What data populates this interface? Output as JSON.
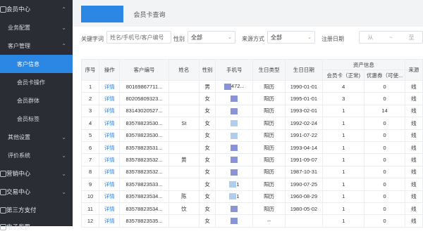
{
  "sidebar": {
    "sections": [
      {
        "label": "会员中心",
        "type": "top",
        "chevron": "⌃"
      },
      {
        "label": "业务配置",
        "type": "group",
        "chevron": "⌄"
      },
      {
        "label": "客户管理",
        "type": "group",
        "chevron": "⌃"
      },
      {
        "label": "客户信息",
        "type": "sub",
        "active": true
      },
      {
        "label": "会员卡操作",
        "type": "sub"
      },
      {
        "label": "会员群体",
        "type": "sub"
      },
      {
        "label": "会员标签",
        "type": "sub"
      },
      {
        "label": "其他设置",
        "type": "group",
        "chevron": "⌄"
      },
      {
        "label": "评价系统",
        "type": "group",
        "chevron": "⌄"
      },
      {
        "label": "营销中心",
        "type": "top",
        "chevron": "⌄"
      },
      {
        "label": "交易中心",
        "type": "top",
        "chevron": "⌄"
      },
      {
        "label": "第三方支付",
        "type": "top"
      },
      {
        "label": "电子发票",
        "type": "top"
      }
    ]
  },
  "tabs": [
    {
      "label": ""
    },
    {
      "label": "会员卡查询"
    }
  ],
  "filters": {
    "keyword_label": "关键字词",
    "keyword_placeholder": "姓名/手机号/客户编号",
    "gender_label": "性别",
    "gender_value": "全部",
    "source_label": "来源方式",
    "source_value": "全部",
    "regdate_label": "注册日期",
    "date_from": "从",
    "date_sep": "~",
    "date_to": "至"
  },
  "table": {
    "group_header": "资产信息",
    "headers": [
      "序号",
      "操作",
      "客户编号",
      "姓名",
      "性别",
      "手机号",
      "生日类型",
      "生日日期",
      "会员卡（正常)",
      "优惠券（可使...",
      "来源"
    ],
    "rows": [
      {
        "no": "1",
        "op": "详情",
        "id": "80169867711...",
        "name": "",
        "gender": "男",
        "phone": "472...",
        "btype": "阳历",
        "bdate": "1990-01-01",
        "card": "4",
        "coupon": "0",
        "src": "线"
      },
      {
        "no": "2",
        "op": "详情",
        "id": "80205809323...",
        "name": "",
        "gender": "女",
        "phone": "",
        "btype": "阳历",
        "bdate": "1995-01-01",
        "card": "3",
        "coupon": "0",
        "src": "线"
      },
      {
        "no": "3",
        "op": "详情",
        "id": "83143020527...",
        "name": "",
        "gender": "女",
        "phone": "",
        "btype": "阳历",
        "bdate": "1993-02-01",
        "card": "1",
        "coupon": "14",
        "src": "线"
      },
      {
        "no": "4",
        "op": "详情",
        "id": "83578823530...",
        "name": "St",
        "gender": "女",
        "phone": "",
        "btype": "阳历",
        "bdate": "1992-02-24",
        "card": "1",
        "coupon": "0",
        "src": "线"
      },
      {
        "no": "5",
        "op": "详情",
        "id": "83578823530...",
        "name": "",
        "gender": "女",
        "phone": "",
        "btype": "阳历",
        "bdate": "1991-07-22",
        "card": "1",
        "coupon": "0",
        "src": "线"
      },
      {
        "no": "6",
        "op": "详情",
        "id": "83578823531...",
        "name": "",
        "gender": "女",
        "phone": "",
        "btype": "阳历",
        "bdate": "1993-04-14",
        "card": "1",
        "coupon": "0",
        "src": "线"
      },
      {
        "no": "7",
        "op": "详情",
        "id": "83578823532...",
        "name": "黄",
        "gender": "女",
        "phone": "",
        "btype": "阳历",
        "bdate": "1991-09-07",
        "card": "1",
        "coupon": "0",
        "src": "线"
      },
      {
        "no": "8",
        "op": "详情",
        "id": "83578823532...",
        "name": "",
        "gender": "女",
        "phone": "",
        "btype": "阳历",
        "bdate": "1987-10-31",
        "card": "1",
        "coupon": "0",
        "src": "线"
      },
      {
        "no": "9",
        "op": "详情",
        "id": "83578823533...",
        "name": "",
        "gender": "女",
        "phone": "1",
        "btype": "阳历",
        "bdate": "1990-07-25",
        "card": "1",
        "coupon": "0",
        "src": "线"
      },
      {
        "no": "10",
        "op": "详情",
        "id": "83578823534...",
        "name": "陈",
        "gender": "女",
        "phone": "1",
        "btype": "阳历",
        "bdate": "1960-08-29",
        "card": "1",
        "coupon": "0",
        "src": "线"
      },
      {
        "no": "11",
        "op": "详情",
        "id": "83578823534...",
        "name": "饮",
        "gender": "女",
        "phone": "",
        "btype": "阳历",
        "bdate": "1980-05-02",
        "card": "1",
        "coupon": "0",
        "src": "线"
      },
      {
        "no": "12",
        "op": "详情",
        "id": "83578823535...",
        "name": "",
        "gender": "女",
        "phone": "",
        "btype": "--",
        "bdate": "",
        "card": "1",
        "coupon": "0",
        "src": "线"
      }
    ]
  },
  "colors": {
    "accent": "#2b86e4",
    "sidebar_bg": "#2a2d34",
    "link": "#2b86e4"
  }
}
